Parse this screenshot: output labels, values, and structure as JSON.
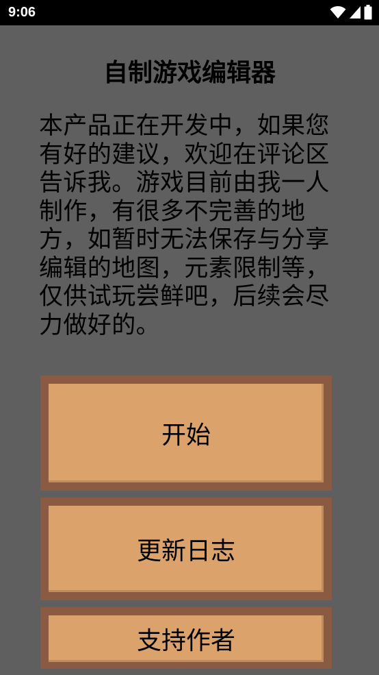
{
  "status_bar": {
    "time": "9:06",
    "icons": [
      "wifi-icon",
      "signal-icon",
      "battery-icon"
    ]
  },
  "title": "自制游戏编辑器",
  "notice_text": "本产品正在开发中，如果您有好的建议，欢迎在评论区告诉我。游戏目前由我一人制作，有很多不完善的地方，如暂时无法保存与分享编辑的地图，元素限制等，仅供试玩尝鲜吧，后续会尽力做好的。",
  "menu": {
    "start_label": "开始",
    "changelog_label": "更新日志",
    "support_label": "支持作者"
  },
  "colors": {
    "background": "#5f5f5f",
    "button_fill": "#dba26b",
    "button_border": "#8b5a42"
  }
}
